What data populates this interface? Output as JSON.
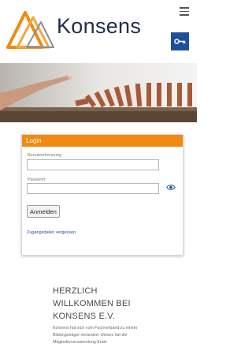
{
  "brand": {
    "name": "Konsens"
  },
  "icons": {
    "menu": "hamburger-menu-icon",
    "key": "key-icon",
    "eye": "eye-icon",
    "logo": "triangle-logo-icon"
  },
  "colors": {
    "accent": "#f08a10",
    "primary": "#1d4f9c",
    "text": "#4a4a4a"
  },
  "login": {
    "header": "Login",
    "username_label": "Benutzerkennung",
    "username_value": "",
    "password_label": "Passwort",
    "password_value": "",
    "submit_label": "Anmelden",
    "forgot_link": "Zugangsdaten vergessen"
  },
  "welcome": {
    "line1": "HERZLICH",
    "line2": "WILLKOMMEN BEI",
    "line3": "KONSENS E.V.",
    "text": "Konsens hat sich vom Fachverband zu einem Bildungsträger verändert. Dieses hat die Mitgliederversammlung Ende"
  }
}
